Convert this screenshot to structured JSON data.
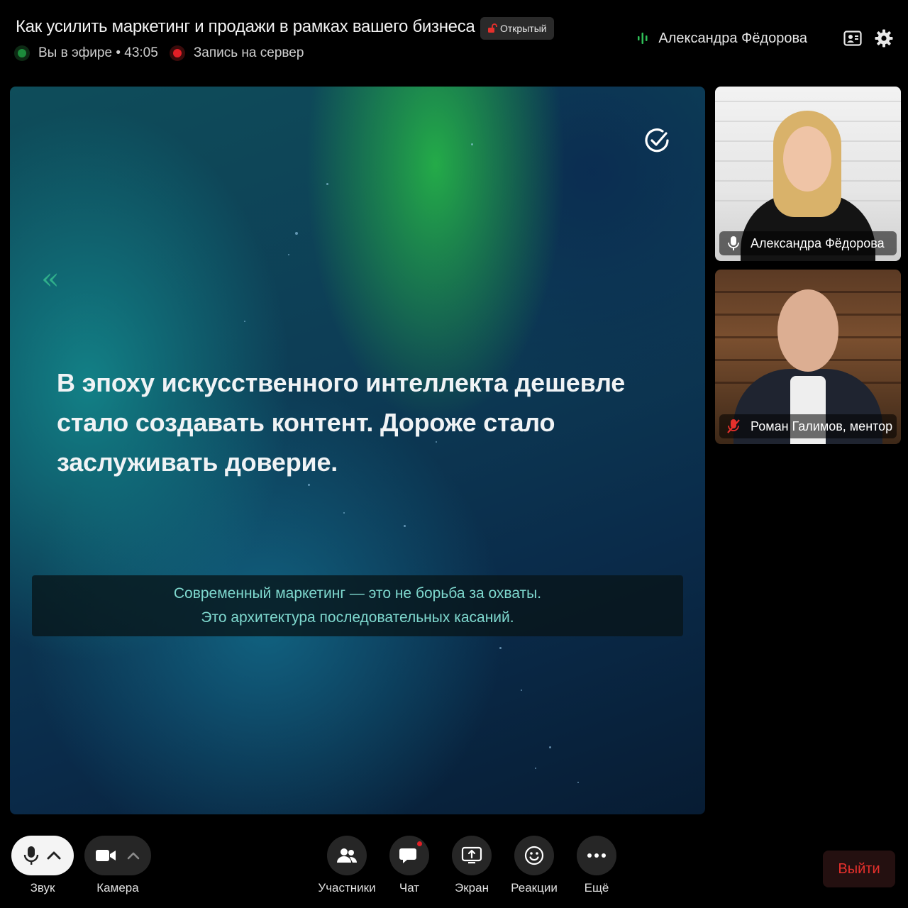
{
  "header": {
    "title": "Как усилить маркетинг и продажи в рамках вашего бизнеса",
    "badge": "Открытый",
    "live_status": "Вы в эфире • 43:05",
    "recording_status": "Запись на сервер",
    "active_speaker": "Александра Фёдорова"
  },
  "slide": {
    "quote_mark": "«",
    "quote": "В эпоху искусственного интеллекта дешевле стало создавать контент. Дороже стало заслуживать доверие.",
    "caption_line1": "Современный маркетинг — это не борьба за охваты.",
    "caption_line2": "Это архитектура последовательных касаний."
  },
  "participants": [
    {
      "name": "Александра Фёдорова",
      "mic": "on"
    },
    {
      "name": "Роман Галимов, ментор",
      "mic": "muted"
    }
  ],
  "toolbar": {
    "sound": "Звук",
    "camera": "Камера",
    "participants": "Участники",
    "chat": "Чат",
    "screen": "Экран",
    "reactions": "Реакции",
    "more": "Ещё",
    "exit": "Выйти"
  },
  "colors": {
    "live": "#1c8b3b",
    "recording": "#e21f26",
    "exit": "#e5302c",
    "caption": "#7fd9cf"
  }
}
